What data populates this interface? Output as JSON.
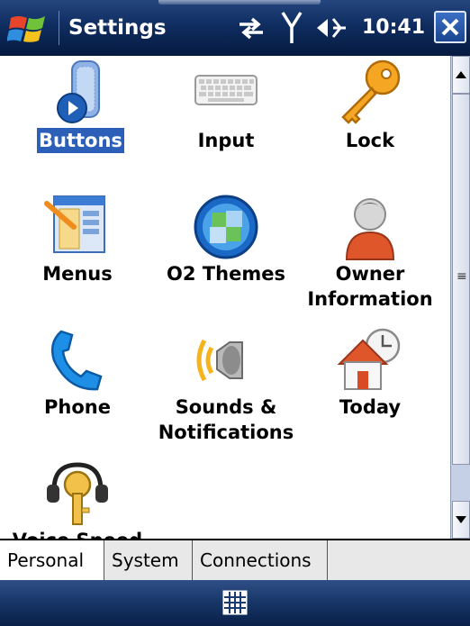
{
  "window": {
    "title": "Settings",
    "time": "10:41"
  },
  "status_icons": [
    "sync-arrows-icon",
    "signal-antenna-icon",
    "volume-speaker-icon"
  ],
  "items": [
    {
      "label": "Buttons",
      "icon": "buttons-icon",
      "selected": true
    },
    {
      "label": "Input",
      "icon": "keyboard-icon"
    },
    {
      "label": "Lock",
      "icon": "key-icon"
    },
    {
      "label": "Menus",
      "icon": "menus-icon"
    },
    {
      "label": "O2 Themes",
      "icon": "themes-globe-icon"
    },
    {
      "label": "Owner\nInformation",
      "icon": "owner-person-icon"
    },
    {
      "label": "Phone",
      "icon": "phone-handset-icon"
    },
    {
      "label": "Sounds &\nNotifications",
      "icon": "sounds-speaker-icon"
    },
    {
      "label": "Today",
      "icon": "today-house-clock-icon"
    },
    {
      "label": "Voice Speed",
      "icon": "voice-headset-key-icon"
    }
  ],
  "tabs": [
    {
      "label": "Personal",
      "active": true
    },
    {
      "label": "System"
    },
    {
      "label": "Connections"
    }
  ],
  "colors": {
    "titlebar": "#0f2d60",
    "selection": "#2b5fb8"
  }
}
